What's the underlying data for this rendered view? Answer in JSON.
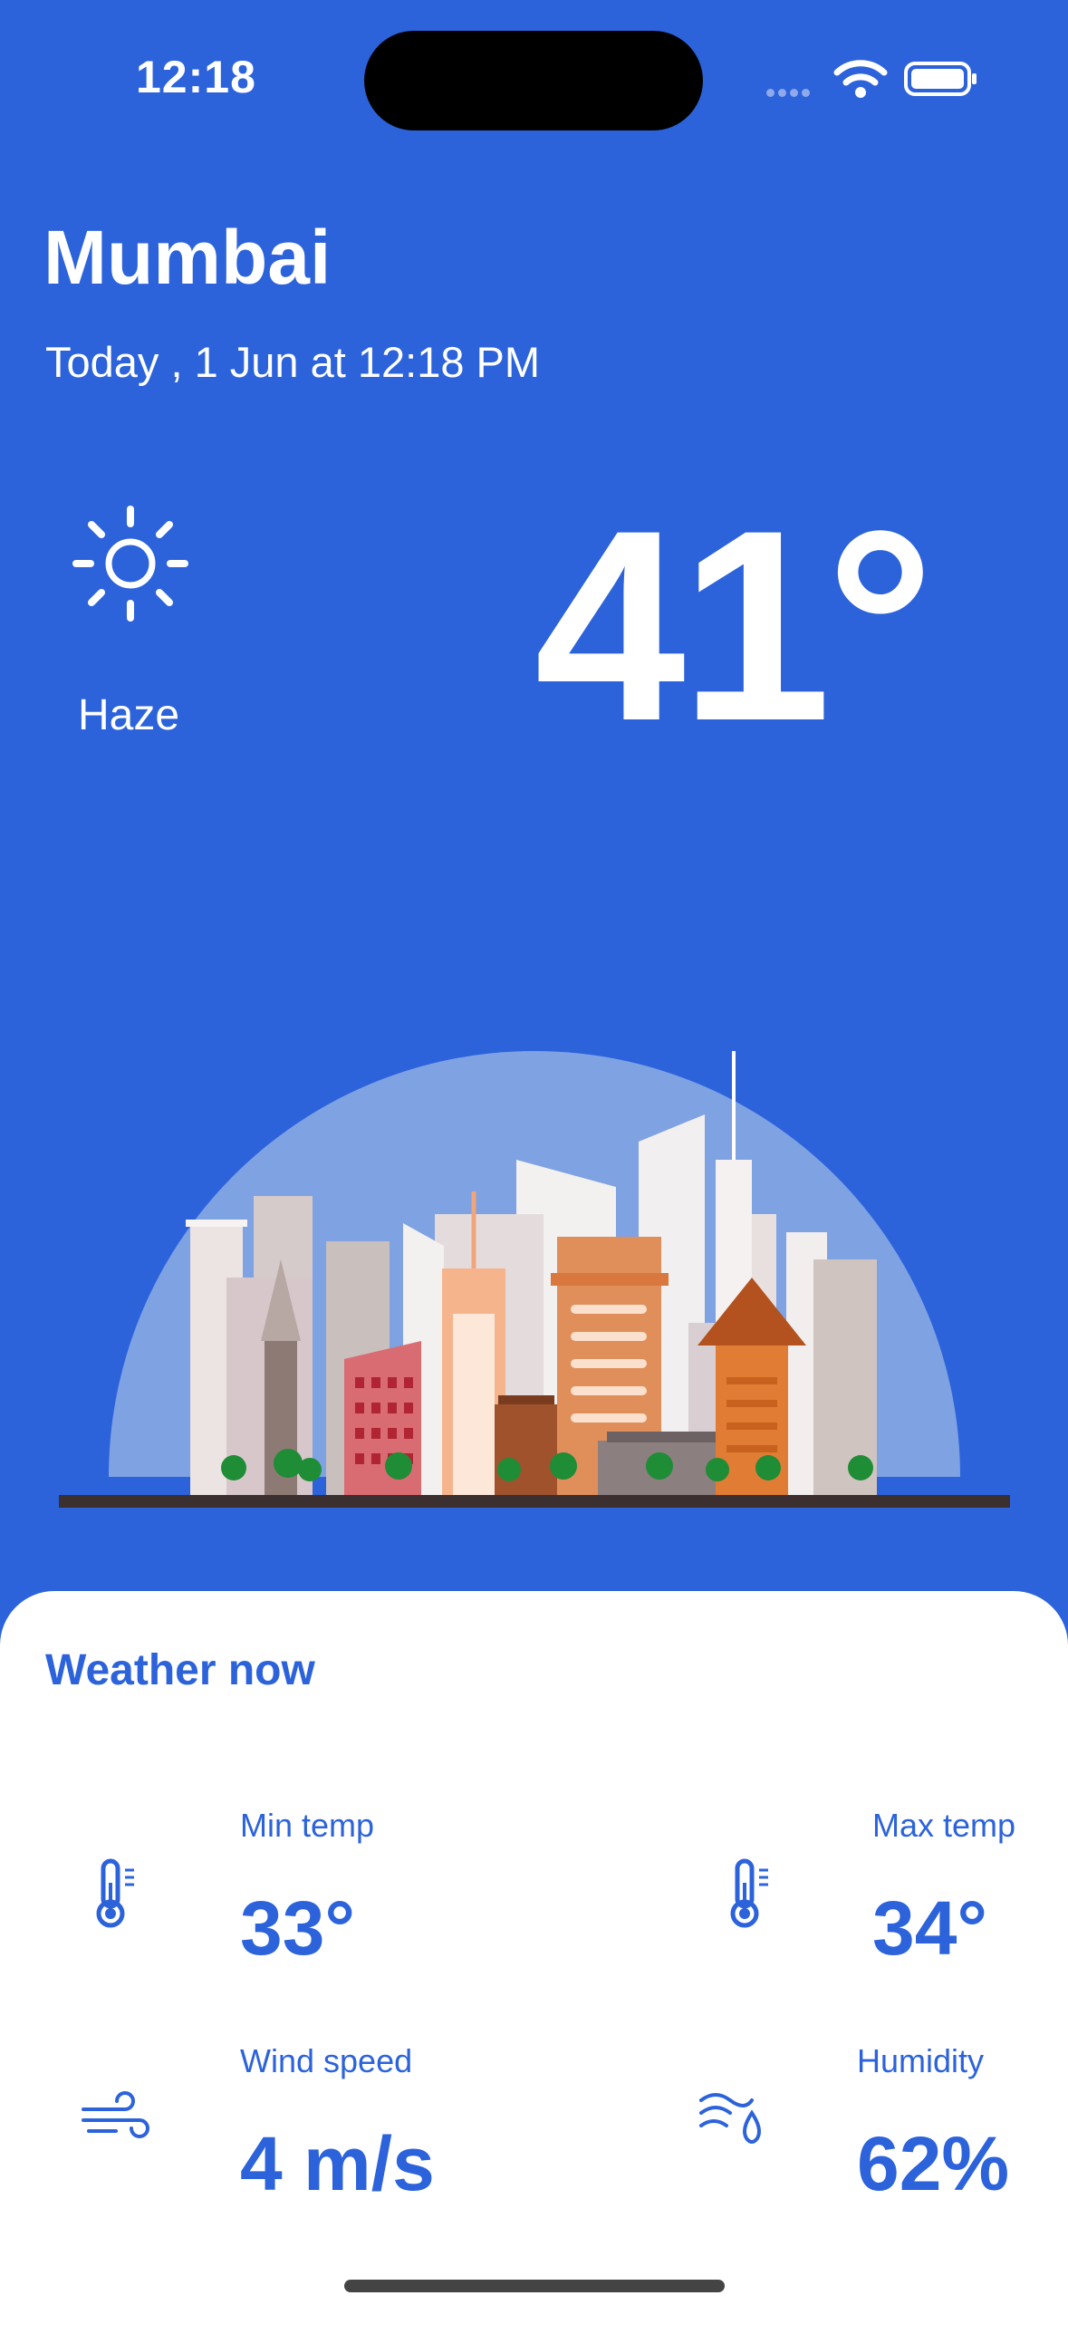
{
  "status_bar": {
    "time": "12:18"
  },
  "header": {
    "city": "Mumbai",
    "date": "Today , 1 Jun at 12:18 PM"
  },
  "current": {
    "icon": "sun-icon",
    "condition": "Haze",
    "temperature": "41°"
  },
  "card": {
    "title": "Weather now",
    "stats": [
      {
        "icon": "thermometer-icon",
        "label": "Min temp",
        "value": "33°"
      },
      {
        "icon": "thermometer-icon",
        "label": "Max temp",
        "value": "34°"
      },
      {
        "icon": "wind-icon",
        "label": "Wind speed",
        "value": "4 m/s"
      },
      {
        "icon": "humidity-icon",
        "label": "Humidity",
        "value": "62%"
      }
    ]
  },
  "colors": {
    "background": "#2c63db",
    "accent": "#2c63db",
    "card": "#ffffff"
  }
}
